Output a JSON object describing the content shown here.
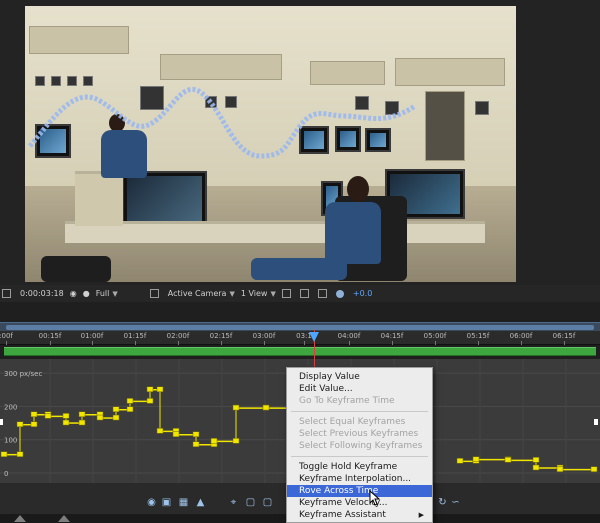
{
  "viewer": {
    "timecode": "0:00:03:18",
    "magnification": "Full",
    "camera": "Active Camera",
    "views": "1 View",
    "exposure": "+0.0"
  },
  "timeline": {
    "ruler_labels": [
      ":00f",
      "00:15f",
      "01:00f",
      "01:15f",
      "02:00f",
      "02:15f",
      "03:00f",
      "03:1",
      "04:00f",
      "04:15f",
      "05:00f",
      "05:15f",
      "06:00f",
      "06:15f"
    ],
    "graph_axis_labels": [
      "300 px/sec",
      "200",
      "100",
      "0"
    ]
  },
  "context_menu": {
    "items": [
      {
        "label": "Display Value",
        "enabled": true
      },
      {
        "label": "Edit Value...",
        "enabled": true
      },
      {
        "label": "Go To Keyframe Time",
        "enabled": false
      },
      {
        "separator": true
      },
      {
        "label": "Select Equal Keyframes",
        "enabled": false
      },
      {
        "label": "Select Previous Keyframes",
        "enabled": false
      },
      {
        "label": "Select Following Keyframes",
        "enabled": false
      },
      {
        "separator": true
      },
      {
        "label": "Toggle Hold Keyframe",
        "enabled": true
      },
      {
        "label": "Keyframe Interpolation...",
        "enabled": true
      },
      {
        "label": "Rove Across Time",
        "enabled": true,
        "highlighted": true
      },
      {
        "label": "Keyframe Velocity...",
        "enabled": true
      },
      {
        "label": "Keyframe Assistant",
        "enabled": true,
        "submenu": true
      }
    ]
  },
  "colors": {
    "menu_highlight": "#3c67d6",
    "keyframe": "#f2e600",
    "graph_bg": "#3b3b3b",
    "layer_bar": "#3ea63e",
    "playhead": "#4fa6ff"
  },
  "icons": [
    "snapshot-icon",
    "color-channel-icon",
    "grid-icon",
    "region-icon",
    "fit-icon",
    "graph-type-icon",
    "motion-path-icon"
  ]
}
